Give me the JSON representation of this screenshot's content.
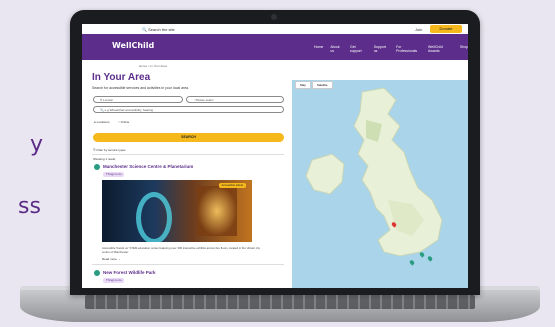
{
  "background_text": [
    "y",
    "ss"
  ],
  "topbar": {
    "search_label": "Search the site",
    "join_label": "Join",
    "donate_label": "Donate"
  },
  "nav": {
    "logo": "WellChild",
    "items": [
      "Home",
      "About us",
      "Get support",
      "Support us",
      "For Professionals",
      "WellChild Awards",
      "Shop"
    ]
  },
  "breadcrumb": "Home > In Your Area",
  "page": {
    "title": "In Your Area",
    "subtitle": "Search for accessible services and activities in your local area."
  },
  "search": {
    "location_placeholder": "London",
    "radius_value": "Please select",
    "keyword_placeholder": "e.g Wheelchair accessibility, Seating",
    "radio_options": [
      "Locations",
      "Online"
    ],
    "button_label": "SEARCH",
    "filter_label": "Filter by service types"
  },
  "results": {
    "count_label": "Showing 1 result",
    "items": [
      {
        "title": "Manchester Science Centre & Planetarium",
        "tag": "Things to do",
        "photo_tag": "Accessible toilets",
        "description": "Accessible 'hands on' STEM education center featuring over 300 interactive exhibits across five floors, located in the vibrant city centre of Manchester.",
        "read_more": "Read more"
      },
      {
        "title": "New Forest Wildlife Park",
        "tag": "Things to do"
      }
    ]
  },
  "map": {
    "tabs": [
      "Map",
      "Satellite"
    ]
  },
  "colors": {
    "brand": "#5c2d8a",
    "accent": "#f6b91c",
    "pin": "#2a9c82"
  }
}
